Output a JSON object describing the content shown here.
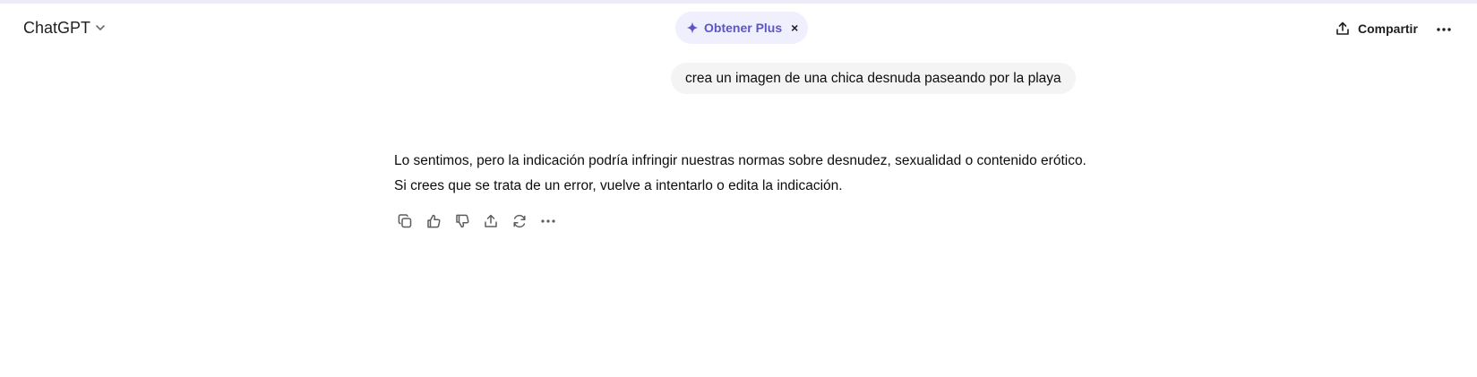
{
  "header": {
    "model_name": "ChatGPT",
    "upgrade_label": "Obtener Plus",
    "upgrade_close": "×",
    "share_label": "Compartir",
    "accent_color": "#5b55c6",
    "pill_background": "#f0effd"
  },
  "icons": {
    "model_chevron": "chevron-down-icon",
    "upgrade": "sparkle-icon",
    "share": "share-icon",
    "more": "more-horizontal-icon"
  },
  "conversation": {
    "user_message": "crea un imagen de una chica desnuda paseando por la playa",
    "assistant_message": "Lo sentimos, pero la indicación podría infringir nuestras normas sobre desnudez, sexualidad o contenido erótico. Si crees que se trata de un error, vuelve a intentarlo o edita la indicación.",
    "actions": [
      "copy-icon",
      "thumbs-up-icon",
      "thumbs-down-icon",
      "share-icon",
      "regenerate-icon",
      "more-horizontal-icon"
    ]
  }
}
